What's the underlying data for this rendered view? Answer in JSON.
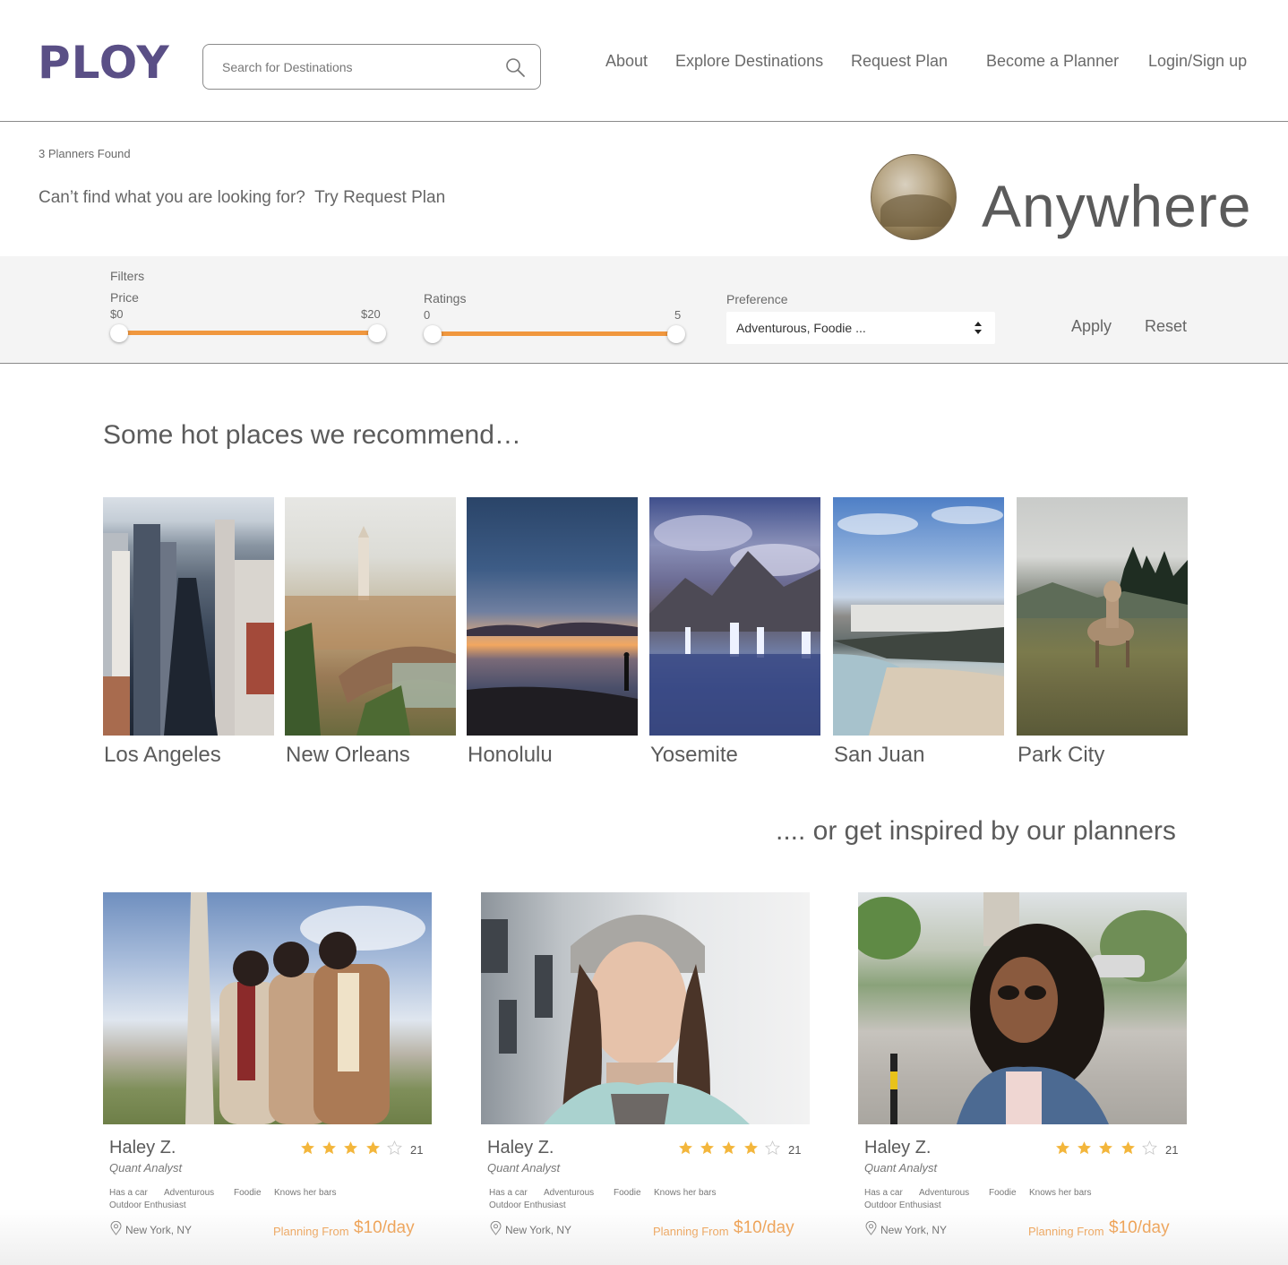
{
  "header": {
    "logo": "PLOY",
    "search": {
      "placeholder": "Search for Destinations",
      "value": ""
    },
    "nav": [
      "About",
      "Explore Destinations",
      "Request Plan",
      "Become a Planner",
      "Login/Sign up"
    ]
  },
  "results": {
    "count_label": "3 Planners Found",
    "prompt": "Can’t find what you are looking for?",
    "prompt_link": "Try Request Plan",
    "location_title": "Anywhere"
  },
  "filters": {
    "title": "Filters",
    "price": {
      "label": "Price",
      "min_label": "$0",
      "max_label": "$20"
    },
    "ratings": {
      "label": "Ratings",
      "min_label": "0",
      "max_label": "5"
    },
    "preference": {
      "label": "Preference",
      "value": "Adventurous, Foodie ..."
    },
    "apply_label": "Apply",
    "reset_label": "Reset"
  },
  "recommend": {
    "heading": "Some hot places we recommend…",
    "places": [
      {
        "name": "Los Angeles"
      },
      {
        "name": "New Orleans"
      },
      {
        "name": "Honolulu"
      },
      {
        "name": "Yosemite"
      },
      {
        "name": "San Juan"
      },
      {
        "name": "Park City"
      }
    ]
  },
  "planners": {
    "heading": ".... or get inspired by our planners",
    "cards": [
      {
        "name": "Haley Z.",
        "title": "Quant Analyst",
        "rating": 4,
        "review_count": "21",
        "tags": [
          "Has a car",
          "Adventurous",
          "Foodie",
          "Knows her bars"
        ],
        "tag_line2": "Outdoor Enthusiast",
        "location": "New York, NY",
        "price_prefix": "Planning From",
        "price": "$10/day"
      },
      {
        "name": "Haley Z.",
        "title": "Quant Analyst",
        "rating": 4,
        "review_count": "21",
        "tags": [
          "Has a car",
          "Adventurous",
          "Foodie",
          "Knows her bars"
        ],
        "tag_line2": "Outdoor Enthusiast",
        "location": "New York, NY",
        "price_prefix": "Planning From",
        "price": "$10/day"
      },
      {
        "name": "Haley Z.",
        "title": "Quant Analyst",
        "rating": 4,
        "review_count": "21",
        "tags": [
          "Has a car",
          "Adventurous",
          "Foodie",
          "Knows her bars"
        ],
        "tag_line2": "Outdoor Enthusiast",
        "location": "New York, NY",
        "price_prefix": "Planning From",
        "price": "$10/day"
      }
    ]
  },
  "colors": {
    "brand": "#5a4f86",
    "accent": "#f0973e",
    "text": "#5b5b5b"
  },
  "icons": [
    "search-icon",
    "sort-arrows-icon",
    "star-icon",
    "location-pin-icon"
  ]
}
